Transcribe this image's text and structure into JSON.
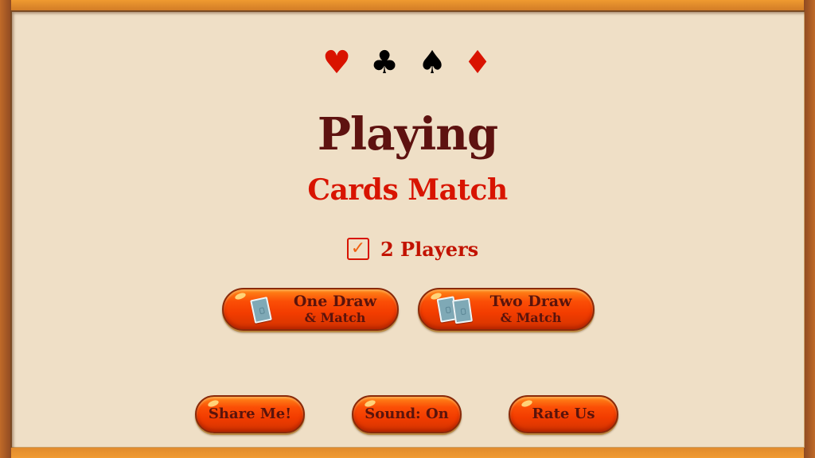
{
  "suits": [
    {
      "name": "heart",
      "glyph": "♥",
      "color": "#d91300"
    },
    {
      "name": "club",
      "glyph": "♣",
      "color": "#000000"
    },
    {
      "name": "spade",
      "glyph": "♠",
      "color": "#000000"
    },
    {
      "name": "diamond",
      "glyph": "♦",
      "color": "#d91300"
    }
  ],
  "title": {
    "main": "Playing",
    "sub": "Cards Match"
  },
  "players_option": {
    "checked": true,
    "check_glyph": "✓",
    "label": "2 Players"
  },
  "mode_buttons": [
    {
      "line1": "One Draw",
      "line2": "& Match",
      "icon": "single-card-icon"
    },
    {
      "line1": "Two Draw",
      "line2": "& Match",
      "icon": "two-cards-icon"
    }
  ],
  "footer_buttons": {
    "share": "Share Me!",
    "sound": "Sound: On",
    "rate": "Rate Us"
  },
  "colors": {
    "background": "#efdfc6",
    "frame": "#e58a2a",
    "title_dark": "#5e1210",
    "title_red": "#d81400",
    "button": "#f23c00",
    "button_text": "#5a140c"
  }
}
